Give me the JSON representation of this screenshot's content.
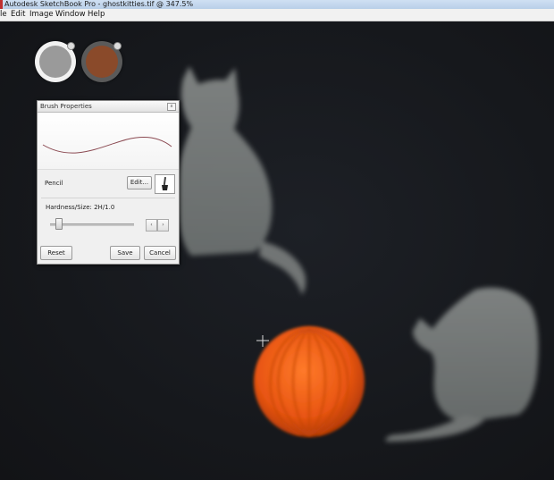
{
  "window": {
    "title": "Autodesk SketchBook Pro - ghostkitties.tif @ 347.5%"
  },
  "menu": {
    "items": [
      "le",
      "Edit",
      "Image",
      "Window",
      "Help"
    ]
  },
  "color_pucks": {
    "left": {
      "color": "#9a9a9a",
      "icon": "brush-puck-icon"
    },
    "right": {
      "color": "#8a4a2a",
      "icon": "color-puck-icon"
    }
  },
  "brush_properties": {
    "title": "Brush Properties",
    "close_glyph": "x",
    "brush_name": "Pencil",
    "edit_label": "Edit...",
    "hardness_label": "Hardness/Size: 2H/1.0",
    "slider_value_fraction": 0.08,
    "step_left": "‹",
    "step_right": "›",
    "reset_label": "Reset",
    "save_label": "Save",
    "cancel_label": "Cancel",
    "stroke_color": "#8b4a52"
  },
  "canvas": {
    "background_color": "#16181c",
    "yarn_color": "#e85512",
    "ghost_color": "#a6aaa8"
  }
}
